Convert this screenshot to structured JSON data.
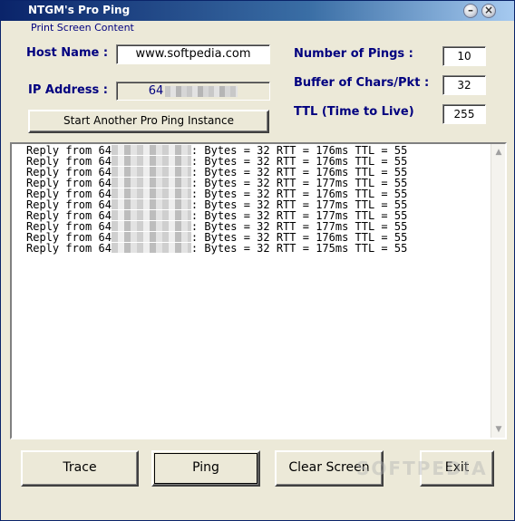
{
  "window": {
    "title": "NTGM's Pro Ping"
  },
  "menu": {
    "print_screen": "Print Screen Content"
  },
  "host": {
    "label": "Host Name :",
    "value": "www.softpedia.com"
  },
  "ip": {
    "label": "IP Address :",
    "value_prefix": "64"
  },
  "pings": {
    "label": "Number of Pings :",
    "value": "10"
  },
  "buffer": {
    "label": "Buffer of Chars/Pkt :",
    "value": "32"
  },
  "ttl": {
    "label": "TTL (Time to Live)",
    "value": "255"
  },
  "start_instance_label": "Start Another Pro Ping Instance",
  "output_lines": [
    {
      "prefix": "Reply from 64",
      "suffix": ": Bytes = 32 RTT = 176ms TTL = 55"
    },
    {
      "prefix": "Reply from 64",
      "suffix": ": Bytes = 32 RTT = 176ms TTL = 55"
    },
    {
      "prefix": "Reply from 64",
      "suffix": ": Bytes = 32 RTT = 176ms TTL = 55"
    },
    {
      "prefix": "Reply from 64",
      "suffix": ": Bytes = 32 RTT = 177ms TTL = 55"
    },
    {
      "prefix": "Reply from 64",
      "suffix": ": Bytes = 32 RTT = 176ms TTL = 55"
    },
    {
      "prefix": "Reply from 64",
      "suffix": ": Bytes = 32 RTT = 177ms TTL = 55"
    },
    {
      "prefix": "Reply from 64",
      "suffix": ": Bytes = 32 RTT = 177ms TTL = 55"
    },
    {
      "prefix": "Reply from 64",
      "suffix": ": Bytes = 32 RTT = 177ms TTL = 55"
    },
    {
      "prefix": "Reply from 64",
      "suffix": ": Bytes = 32 RTT = 176ms TTL = 55"
    },
    {
      "prefix": "Reply from 64",
      "suffix": ": Bytes = 32 RTT = 175ms TTL = 55"
    }
  ],
  "buttons": {
    "trace": "Trace",
    "ping": "Ping",
    "clear": "Clear Screen",
    "exit": "Exit"
  },
  "watermark": "SOFTPEDIA",
  "colors": {
    "label": "#00007f",
    "title_start": "#0a246a",
    "title_end": "#a6caf0",
    "window_bg": "#ece9d8"
  },
  "icons": {
    "minimize": "minimize-icon",
    "close": "close-icon",
    "scroll_up": "scroll-up-arrow-icon",
    "scroll_down": "scroll-down-arrow-icon"
  }
}
